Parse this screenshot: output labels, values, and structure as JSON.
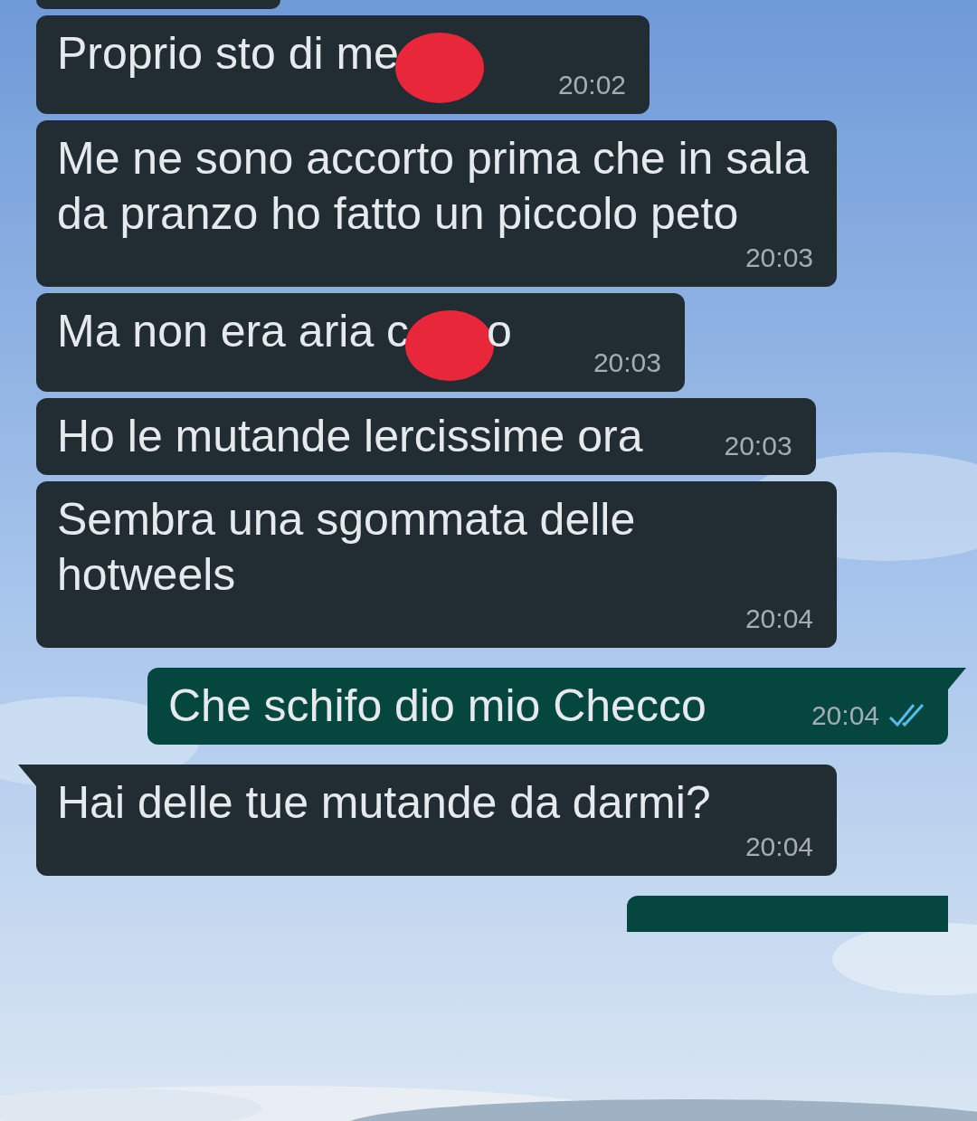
{
  "messages": [
    {
      "kind": "cut",
      "outgoing": false
    },
    {
      "kind": "message",
      "outgoing": false,
      "tail": false,
      "parts": [
        {
          "kind": "text",
          "text": "Proprio sto di me"
        },
        {
          "kind": "redaction"
        }
      ],
      "time": "20:02"
    },
    {
      "kind": "message",
      "outgoing": false,
      "tail": false,
      "parts": [
        {
          "kind": "text",
          "text": "Me ne sono accorto prima che in sala da pranzo ho fatto un piccolo peto"
        }
      ],
      "time": "20:03"
    },
    {
      "kind": "message",
      "outgoing": false,
      "tail": false,
      "parts": [
        {
          "kind": "text",
          "text": "Ma non era aria c"
        },
        {
          "kind": "redaction"
        },
        {
          "kind": "text",
          "text": "o"
        }
      ],
      "time": "20:03"
    },
    {
      "kind": "message",
      "outgoing": false,
      "tail": false,
      "parts": [
        {
          "kind": "text",
          "text": "Ho le mutande lercissime ora"
        }
      ],
      "time": "20:03"
    },
    {
      "kind": "message",
      "outgoing": false,
      "tail": false,
      "parts": [
        {
          "kind": "text",
          "text": "Sembra una sgommata delle hotweels"
        }
      ],
      "time": "20:04"
    },
    {
      "kind": "message",
      "outgoing": true,
      "tail": true,
      "parts": [
        {
          "kind": "text",
          "text": "Che schifo dio mio Checco"
        }
      ],
      "time": "20:04",
      "read": true
    },
    {
      "kind": "message",
      "outgoing": false,
      "tail": true,
      "parts": [
        {
          "kind": "text",
          "text": "Hai delle tue mutande da darmi?"
        }
      ],
      "time": "20:04"
    },
    {
      "kind": "cut",
      "outgoing": true
    }
  ]
}
